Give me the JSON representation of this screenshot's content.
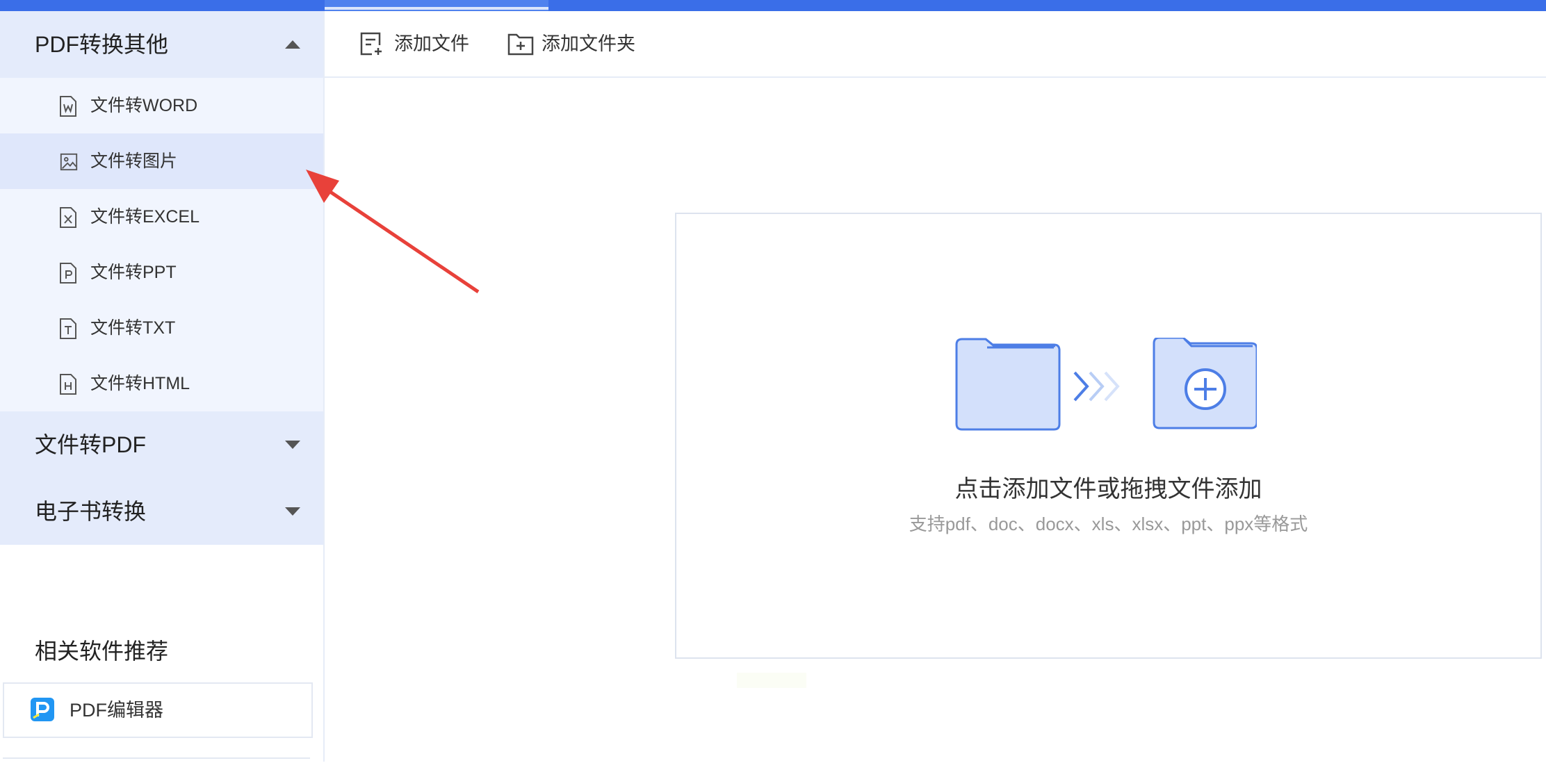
{
  "sidebar": {
    "group_pdf_to_other": {
      "label": "PDF转换其他",
      "items": [
        {
          "label": "文件转WORD",
          "icon": "word-file-icon",
          "letter": "W"
        },
        {
          "label": "文件转图片",
          "icon": "image-file-icon",
          "letter": ""
        },
        {
          "label": "文件转EXCEL",
          "icon": "excel-file-icon",
          "letter": "X"
        },
        {
          "label": "文件转PPT",
          "icon": "ppt-file-icon",
          "letter": "P"
        },
        {
          "label": "文件转TXT",
          "icon": "txt-file-icon",
          "letter": "T"
        },
        {
          "label": "文件转HTML",
          "icon": "html-file-icon",
          "letter": "H"
        }
      ],
      "selected_index": 1
    },
    "group_file_to_pdf": {
      "label": "文件转PDF"
    },
    "group_ebook": {
      "label": "电子书转换"
    },
    "recommend": {
      "title": "相关软件推荐",
      "items": [
        {
          "label": "PDF编辑器",
          "icon": "pdf-editor-logo-icon"
        }
      ]
    }
  },
  "toolbar": {
    "add_file_label": "添加文件",
    "add_folder_label": "添加文件夹"
  },
  "dropzone": {
    "title": "点击添加文件或拖拽文件添加",
    "subtitle": "支持pdf、doc、docx、xls、xlsx、ppt、ppx等格式"
  },
  "colors": {
    "accent": "#3a6ee8",
    "sidebar_header_bg": "#e4ebfb",
    "submenu_bg": "#f1f5fe",
    "selected_bg": "#dfe7fb",
    "annotation_arrow": "#e8413a"
  }
}
